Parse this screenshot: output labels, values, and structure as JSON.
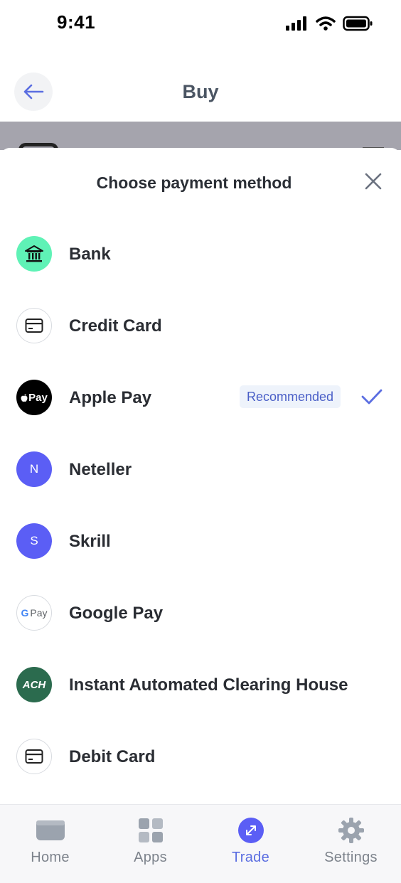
{
  "status_bar": {
    "time": "9:41",
    "icons": [
      "cellular-signal-icon",
      "wifi-icon",
      "battery-icon"
    ]
  },
  "header": {
    "title": "Buy",
    "back_icon": "arrow-left-icon"
  },
  "sheet": {
    "title": "Choose payment method",
    "close_icon": "close-icon",
    "methods": [
      {
        "label": "Bank",
        "icon": "bank-icon"
      },
      {
        "label": "Credit Card",
        "icon": "card-icon"
      },
      {
        "label": "Apple Pay",
        "icon": "apple-pay-icon",
        "icon_text": "Pay",
        "badge": "Recommended",
        "selected": true
      },
      {
        "label": "Neteller",
        "icon": "neteller-icon",
        "icon_text": "N"
      },
      {
        "label": "Skrill",
        "icon": "skrill-icon",
        "icon_text": "S"
      },
      {
        "label": "Google Pay",
        "icon": "google-pay-icon",
        "icon_text": "Pay"
      },
      {
        "label": "Instant Automated Clearing House",
        "icon": "ach-icon",
        "icon_text": "ACH"
      },
      {
        "label": "Debit Card",
        "icon": "card-icon"
      }
    ]
  },
  "tabbar": {
    "tabs": [
      {
        "label": "Home",
        "icon": "wallet-icon"
      },
      {
        "label": "Apps",
        "icon": "apps-grid-icon"
      },
      {
        "label": "Trade",
        "icon": "trade-icon",
        "active": true
      },
      {
        "label": "Settings",
        "icon": "gear-icon"
      }
    ]
  },
  "colors": {
    "accent": "#5b6ee1",
    "badge_bg": "#eef3fb",
    "bank_icon_bg": "#5ff2b6",
    "purple": "#5b5ef5"
  }
}
